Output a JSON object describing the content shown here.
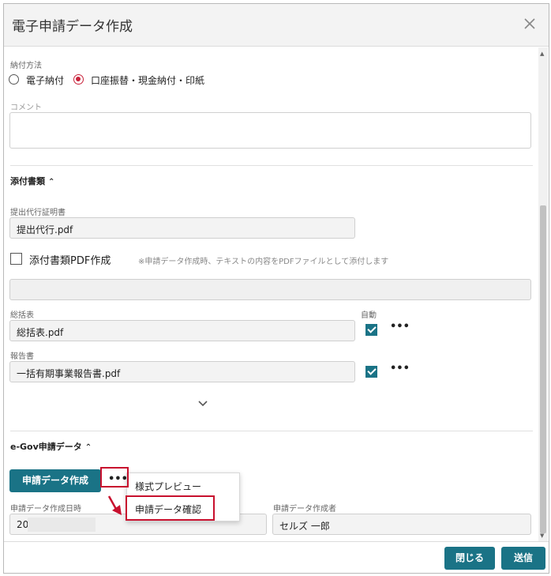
{
  "dialog": {
    "title": "電子申請データ作成"
  },
  "payment": {
    "label": "納付方法",
    "options": [
      "電子納付",
      "口座振替・現金納付・印紙"
    ],
    "selected_index": 1
  },
  "comment": {
    "label": "コメント",
    "value": ""
  },
  "attachments": {
    "section_title": "添付書類",
    "proxy_cert_label": "提出代行証明書",
    "proxy_cert_value": "提出代行.pdf",
    "pdf_create_label": "添付書類PDF作成",
    "pdf_create_note": "※申請データ作成時、テキストの内容をPDFファイルとして添付します",
    "pdf_create_checked": false,
    "pdf_text_value": "",
    "summary_label": "総括表",
    "auto_label": "自動",
    "summary_value": "総括表.pdf",
    "summary_checked": true,
    "report_label": "報告書",
    "report_value": "一括有期事業報告書.pdf",
    "report_checked": true
  },
  "egov": {
    "section_title": "e-Gov申請データ",
    "create_button": "申請データ作成",
    "created_at_label": "申請データ作成日時",
    "created_at_value": "20",
    "creator_label": "申請データ作成者",
    "creator_value": "セルズ 一郎"
  },
  "menu": {
    "items": [
      "様式プレビュー",
      "申請データ確認"
    ]
  },
  "footer": {
    "close_button": "閉じる",
    "send_button": "送信"
  },
  "colors": {
    "accent": "#1a7386",
    "radio_selected": "#c8223a",
    "highlight": "#c8102e"
  }
}
